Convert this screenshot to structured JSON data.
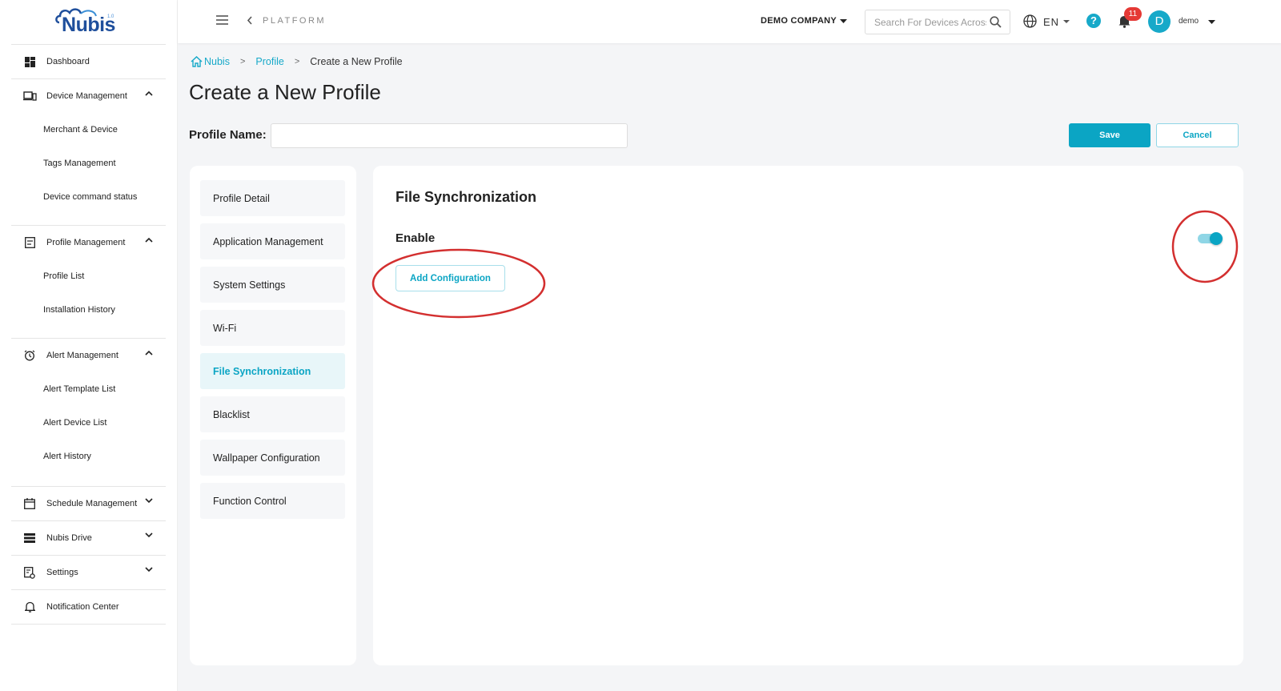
{
  "brand": {
    "logo_text": "Nubis",
    "logo_version": "1.0"
  },
  "sidebar": {
    "dashboard": "Dashboard",
    "device_management": {
      "label": "Device Management",
      "items": [
        "Merchant & Device",
        "Tags Management",
        "Device command status"
      ]
    },
    "profile_management": {
      "label": "Profile Management",
      "items": [
        "Profile List",
        "Installation History"
      ]
    },
    "alert_management": {
      "label": "Alert Management",
      "items": [
        "Alert Template List",
        "Alert Device List",
        "Alert History"
      ]
    },
    "schedule_management": "Schedule Management",
    "nubis_drive": "Nubis Drive",
    "settings": "Settings",
    "notification_center": "Notification Center"
  },
  "topbar": {
    "platform": "PLATFORM",
    "company": "DEMO COMPANY",
    "search_placeholder": "Search For Devices Across",
    "language": "EN",
    "help": "?",
    "notification_count": "11",
    "avatar_letter": "D",
    "username": "demo"
  },
  "breadcrumb": {
    "home": "Nubis",
    "profile": "Profile",
    "current": "Create a New Profile"
  },
  "page": {
    "title": "Create a New Profile",
    "profile_name_label": "Profile Name:",
    "profile_name_value": "",
    "save": "Save",
    "cancel": "Cancel"
  },
  "profile_menu": {
    "items": [
      "Profile Detail",
      "Application Management",
      "System Settings",
      "Wi-Fi",
      "File Synchronization",
      "Blacklist",
      "Wallpaper Configuration",
      "Function Control"
    ],
    "active": "File Synchronization"
  },
  "file_sync": {
    "title": "File Synchronization",
    "enable_label": "Enable",
    "enabled": true,
    "add_configuration": "Add Configuration"
  },
  "colors": {
    "accent": "#0ba5c4",
    "brand": "#1f4f9c",
    "badge": "#e53935",
    "annotation": "#d32f2f"
  }
}
